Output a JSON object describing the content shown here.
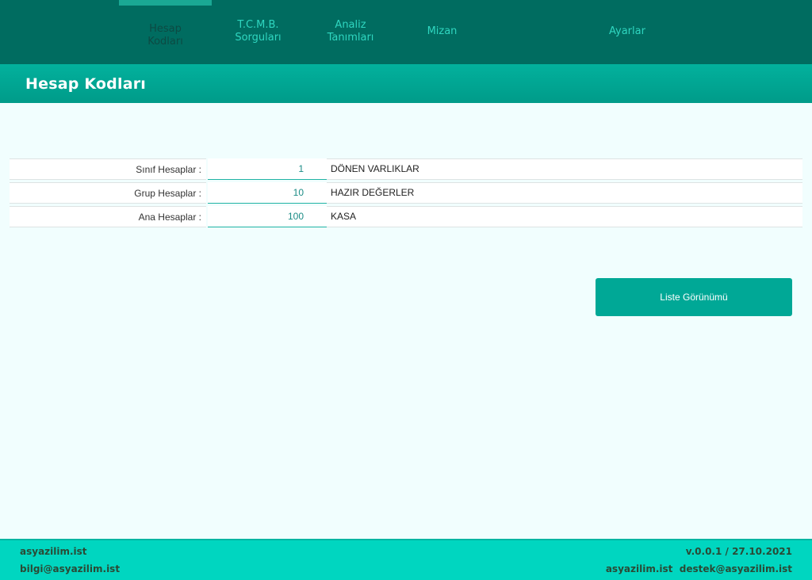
{
  "nav": {
    "items": [
      {
        "label": "Hesap\nKodları",
        "active": true
      },
      {
        "label": "T.C.M.B.\nSorguları",
        "active": false
      },
      {
        "label": "Analiz\nTanımları",
        "active": false
      },
      {
        "label": "Mizan",
        "active": false
      },
      {
        "label": "Ayarlar",
        "active": false
      }
    ]
  },
  "page": {
    "title": "Hesap Kodları"
  },
  "accounts": [
    {
      "label": "Sınıf Hesaplar :",
      "code": "1",
      "name": "DÖNEN VARLIKLAR"
    },
    {
      "label": "Grup Hesaplar :",
      "code": "10",
      "name": "HAZIR DEĞERLER"
    },
    {
      "label": "Ana Hesaplar :",
      "code": "100",
      "name": "KASA"
    }
  ],
  "actions": {
    "list_view": "Liste Görünümü"
  },
  "footer": {
    "site": "asyazilim.ist",
    "email": "bilgi@asyazilim.ist",
    "version": "v.0.0.1 / 27.10.2021",
    "support_site": "asyazilim.ist",
    "support_email": "destek@asyazilim.ist"
  },
  "colors": {
    "topbar": "#006c60",
    "accent": "#00a896",
    "footer": "#00d6c0",
    "background": "#f1fefe"
  }
}
